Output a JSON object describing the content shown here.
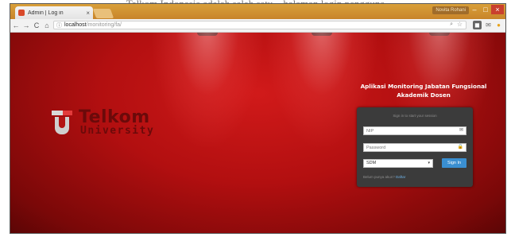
{
  "background_caption": "Telkom Indonesia adalah salah satu... halaman login pengguna",
  "browser": {
    "tab_title": "Admin | Log in",
    "tab_close": "×",
    "user_badge": "Novita Rohani",
    "window_controls": {
      "minimize": "–",
      "maximize": "□",
      "close": "×"
    },
    "nav": {
      "back": "←",
      "forward": "→",
      "reload": "C",
      "home": "⌂"
    },
    "url_host": "localhost",
    "url_path": "/monitoring/fa/",
    "info_icon": "ⓘ",
    "zoom_icon": "🔍",
    "star_icon": "☆",
    "extensions": [
      "ext-icon",
      "mail-icon",
      "notification-icon"
    ]
  },
  "logo": {
    "brand": "Telkom",
    "sub": "University",
    "colors": {
      "mark_red": "#e23b3b",
      "mark_gray": "#cfcfcf",
      "text": "#6b0a0a"
    }
  },
  "app_title": {
    "line1": "Aplikasi Monitoring Jabatan Fungsional",
    "line2": "Akademik Dosen"
  },
  "login": {
    "hint": "Sign in to start your session",
    "nip_placeholder": "NIP",
    "password_placeholder": "Password",
    "role_selected": "SDM",
    "role_caret": "▾",
    "signin_label": "Sign In",
    "register_text": "Belum punya akun?",
    "register_link": "Daftar"
  },
  "colors": {
    "page_red": "#b20f10",
    "panel_bg": "#3b3b3b",
    "button_blue": "#3a8fd1",
    "link_blue": "#6fb1e6"
  }
}
